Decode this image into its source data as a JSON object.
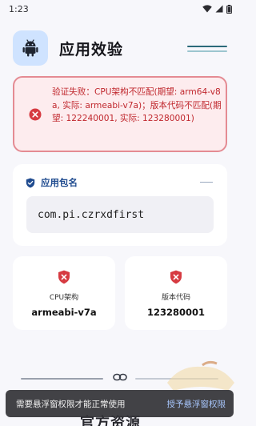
{
  "status_bar": {
    "time": "1:23",
    "icons": [
      "wifi-icon",
      "signal-icon",
      "battery-icon"
    ]
  },
  "header": {
    "app_icon": "android-icon",
    "title": "应用效验"
  },
  "error_card": {
    "icon": "error-circle-icon",
    "message": "验证失败：CPU架构不匹配(期望: arm64-v8a, 实际: armeabi-v7a)；版本代码不匹配(期望: 122240001, 实际: 123280001)"
  },
  "package_card": {
    "icon": "shield-check-icon",
    "title": "应用包名",
    "package_name": "com.pi.czrxdfirst"
  },
  "info_cards": [
    {
      "icon": "error-shield-icon",
      "label": "CPU架构",
      "value": "armeabi-v7a"
    },
    {
      "icon": "error-shield-icon",
      "label": "版本代码",
      "value": "123280001"
    }
  ],
  "official_section": {
    "icon": "link-icon",
    "title_visible": "官方资源"
  },
  "toast": {
    "message": "需要悬浮窗权限才能正常使用",
    "action": "授予悬浮窗权限"
  },
  "colors": {
    "background": "#f7f7fb",
    "error_red": "#c0272d",
    "error_bg": "#fdecee",
    "accent_blue": "#1f4b8f",
    "icon_box": "#cfe3ff"
  }
}
